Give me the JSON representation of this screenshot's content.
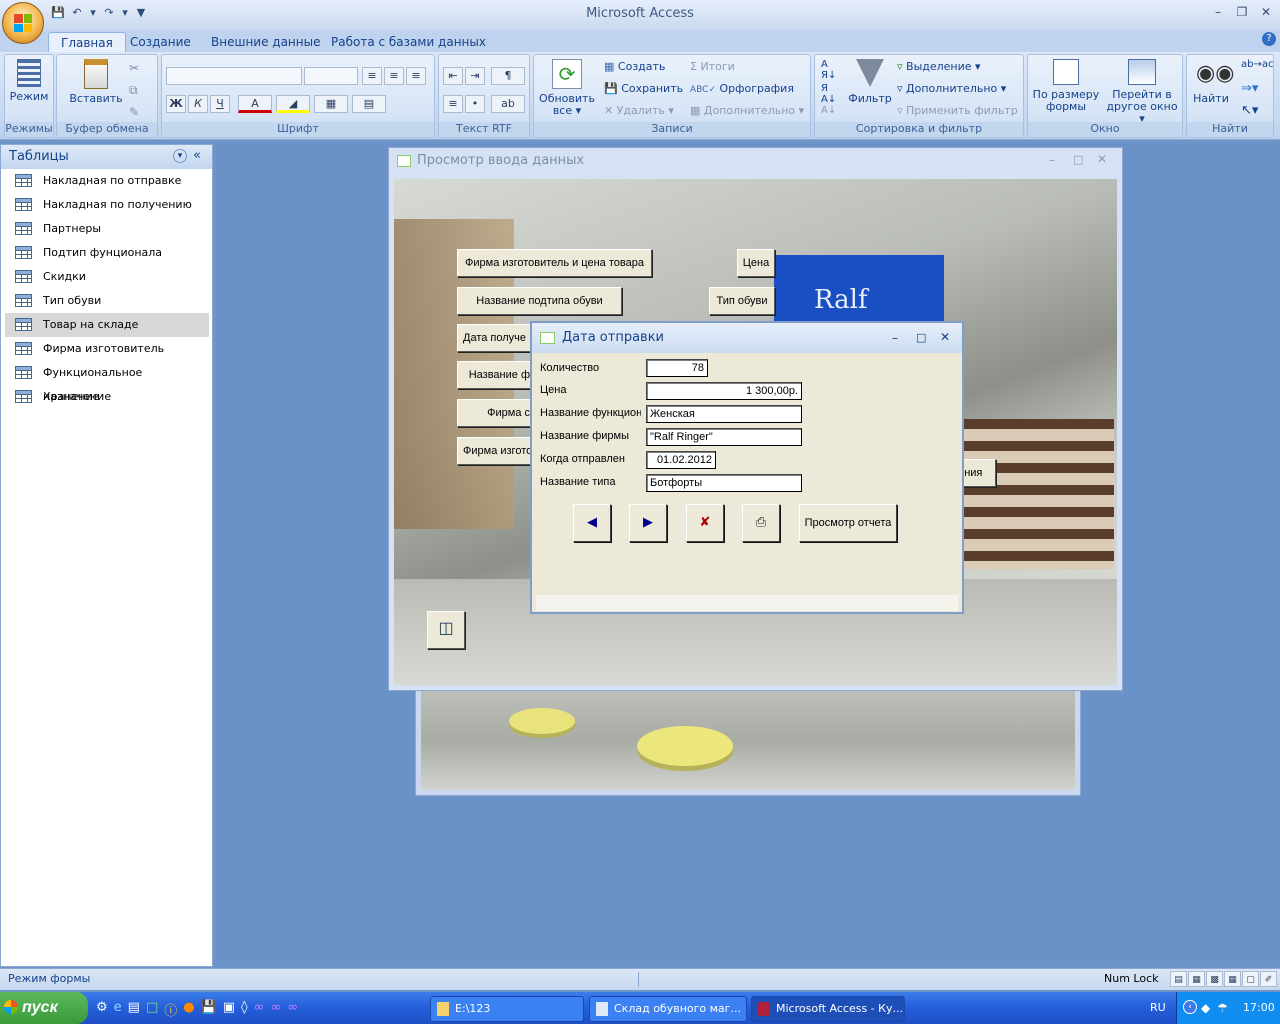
{
  "app": {
    "title": "Microsoft Access"
  },
  "quick_access": {
    "icons": [
      "save-icon",
      "undo-icon",
      "redo-icon",
      "customize-icon"
    ]
  },
  "tabs": [
    "Главная",
    "Создание",
    "Внешние данные",
    "Работа с базами данных"
  ],
  "ribbon": {
    "modes": {
      "label": "Режим",
      "group": "Режимы"
    },
    "clipboard": {
      "label": "Вставить",
      "group": "Буфер обмена"
    },
    "font": {
      "group": "Шрифт",
      "bold": "Ж",
      "italic": "К",
      "underline": "Ч",
      "font_color": "A"
    },
    "rtf": {
      "group": "Текст RTF"
    },
    "records": {
      "refresh": "Обновить",
      "refresh_sub": "все",
      "create": "Создать",
      "save": "Сохранить",
      "delete": "Удалить",
      "totals": "Итоги",
      "spelling": "Орфография",
      "more": "Дополнительно",
      "group": "Записи"
    },
    "sort_filter": {
      "filter": "Фильтр",
      "selection": "Выделение",
      "advanced": "Дополнительно",
      "apply": "Применить фильтр",
      "group": "Сортировка и фильтр"
    },
    "window": {
      "fit": "По размеру",
      "fit_sub": "формы",
      "switch": "Перейти в",
      "switch_sub": "другое окно",
      "group": "Окно"
    },
    "find": {
      "label": "Найти",
      "group": "Найти"
    }
  },
  "nav": {
    "title": "Таблицы",
    "items": [
      "Накладная по отправке",
      "Накладная по получению",
      "Партнеры",
      "Подтип фунционала",
      "Скидки",
      "Тип обуви",
      "Товар на складе",
      "Фирма изготовитель",
      "Функциональное назначение",
      "Хранение"
    ],
    "selected": "Товар на складе"
  },
  "main_form": {
    "title": "Просмотр ввода данных",
    "buttons": {
      "maker_price": "Фирма изготовитель и цена товара",
      "price": "Цена",
      "subtype": "Название подтипа обуви",
      "shoe_type": "Тип обуви",
      "received": "Дата получе",
      "name_f": "Название ф",
      "firm": "Фирма с",
      "firm_maker": "Фирма изгото",
      "storage": "нения"
    }
  },
  "modal": {
    "title": "Дата отправки",
    "fields": [
      {
        "label": "Количество",
        "value": "78"
      },
      {
        "label": "Цена",
        "value": "1 300,00р."
      },
      {
        "label": "Название функцион",
        "value": "Женская"
      },
      {
        "label": "Название фирмы",
        "value": "\"Ralf Ringer\""
      },
      {
        "label": "Когда отправлен",
        "value": "01.02.2012"
      },
      {
        "label": "Название типа",
        "value": "Ботфорты"
      }
    ],
    "report_button": "Просмотр отчета"
  },
  "status": {
    "left": "Режим формы",
    "numlock": "Num Lock"
  },
  "taskbar": {
    "start": "пуск",
    "items": [
      "E:\\123",
      "Склад обувного маг...",
      "Microsoft Access - Ку..."
    ],
    "lang": "RU",
    "time": "17:00"
  },
  "colors": {
    "ribbon_text": "#15428b",
    "mdi_bg": "#6b92c8",
    "taskbar": "#245edb",
    "start": "#3a9b3a"
  }
}
